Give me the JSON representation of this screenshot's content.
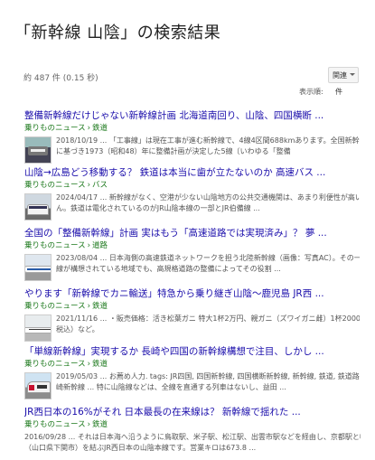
{
  "page": {
    "title": "「新幹線 山陰」の検索結果"
  },
  "stats": {
    "text": "約 487 件 (0.15 秒)"
  },
  "controls": {
    "sort_value": "関連",
    "display_label": "表示順:",
    "display_value": "件"
  },
  "results": [
    {
      "title": "整備新幹線だけじゃない新幹線計画 北海道南回り、山陰、四国横断 ...",
      "source": "乗りものニュース",
      "category": "鉄道",
      "snippet": [
        "2018/10/19 ... 「工事線」は現在工事が進む新幹線で、4線4区間688kmあります。全国新幹線鉄道整備法",
        "に基づき1973（昭和48）年に整備計画が決定した5線〔いわゆる「整備"
      ]
    },
    {
      "title": "山陰→広島どう移動する？ 鉄道は本当に歯が立たないのか 高速バス ...",
      "source": "乗りものニュース",
      "category": "バス",
      "snippet": [
        "2024/04/17 ... 新幹線がなく、空港が少ない山陰地方の公共交通機関は、あまり利便性が高いとはいえませ",
        "ん。鉄道は電化されているのがJR山陰本線の一部とJR伯備線 ..."
      ]
    },
    {
      "title": "全国の「整備新幹線」計画 実はもう「高速道路では実現済み」？ 夢 ...",
      "source": "乗りものニュース",
      "category": "道路",
      "snippet": [
        "2023/08/04 ... 日本海側の高速鉄道ネットワークを担う北陸新幹線（画像：写真AC）。その一方で、新幹",
        "線が構想されている地域でも、高規格道路の整備によってその役割 ..."
      ]
    },
    {
      "title": "やります「新幹線でカニ輸送」特急から乗り継ぎ山陰～鹿児島 JR西 ...",
      "source": "乗りものニュース",
      "category": "鉄道",
      "snippet": [
        "2021/11/16 ... ・販売価格：活き松葉ガニ 特大1杯2万円、親ガニ（ズワイガニ雌）1杯2000円（いずれも",
        "税込）など。"
      ]
    },
    {
      "title": "「単線新幹線」実現するか 長崎や四国の新幹線構想で注目、しかし ...",
      "source": "乗りものニュース",
      "category": "鉄道",
      "snippet": [
        "2019/05/03 ... お薦め人力. tags: JR四国, 四国新幹線, 四国横断新幹線, 新幹線, 鉄道, 鉄道路線, 長",
        "崎新幹線 ... 特に山陰線などは、全線を直通する列車はないし、益田 ..."
      ]
    },
    {
      "title": "JR西日本の16%がそれ 日本最長の在来線は？ 新幹線で揺れた ...",
      "source": "乗りものニュース",
      "category": "鉄道",
      "snippet": [
        "2016/09/28 ... それは日本海へ沿うように鳥取駅、米子駅、松江駅、出雲市駅などを経由し、京都駅と幡生駅",
        "（山口県下関市）を結ぶJR西日本の山陰本線です。営業キロは673.8 ..."
      ]
    }
  ]
}
